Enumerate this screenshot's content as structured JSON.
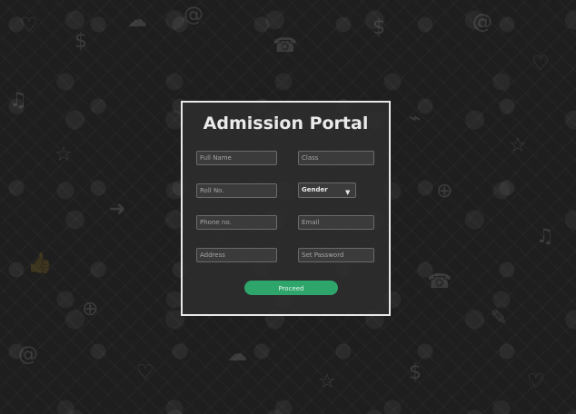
{
  "form": {
    "title": "Admission Portal",
    "fields": {
      "full_name_placeholder": "Full Name",
      "class_placeholder": "Class",
      "roll_no_placeholder": "Roll No.",
      "gender_selected": "Gender",
      "phone_placeholder": "Phone no.",
      "email_placeholder": "Email",
      "address_placeholder": "Address",
      "password_placeholder": "Set Password"
    },
    "proceed_label": "Proceed"
  },
  "colors": {
    "background": "#1e1e1e",
    "panel_border": "#e8e8e8",
    "accent": "#2ea56a"
  },
  "icons": [
    "chevron-down-icon"
  ]
}
